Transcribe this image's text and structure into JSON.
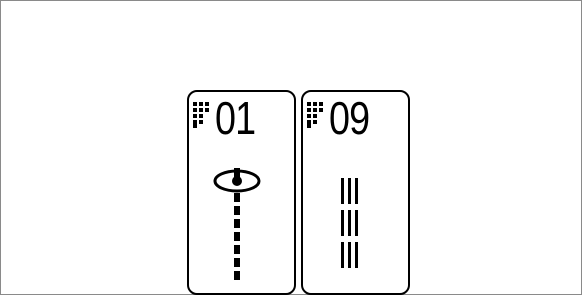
{
  "stitch_panel": {
    "cards": [
      {
        "number": "01",
        "stitch_icon": "buttonhole-stitch-icon"
      },
      {
        "number": "09",
        "stitch_icon": "triple-straight-stitch-icon"
      }
    ]
  },
  "colors": {
    "border": "#000000",
    "background": "#ffffff",
    "frame_border": "#8a8a8a"
  }
}
